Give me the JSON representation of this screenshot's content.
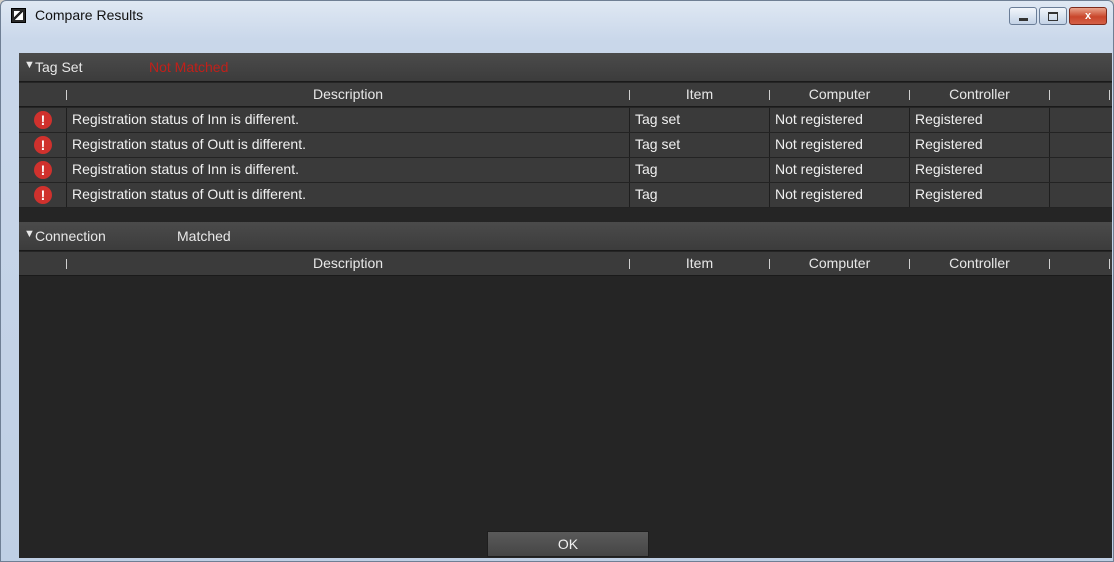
{
  "window": {
    "title": "Compare Results",
    "app_icon": "app-logo-icon",
    "controls": [
      "minimize-icon",
      "maximize-icon",
      "close-icon"
    ],
    "close_glyph": "x"
  },
  "columns": {
    "description": "Description",
    "item": "Item",
    "computer": "Computer",
    "controller": "Controller"
  },
  "sections": [
    {
      "toggle_glyph": "▼",
      "title": "Tag Set",
      "status": "Not Matched",
      "status_color": "#c0201a",
      "rows": [
        {
          "icon": "error-icon",
          "description": "Registration status of Inn is different.",
          "item": "Tag set",
          "computer": "Not registered",
          "controller": "Registered"
        },
        {
          "icon": "error-icon",
          "description": "Registration status of Outt is different.",
          "item": "Tag set",
          "computer": "Not registered",
          "controller": "Registered"
        },
        {
          "icon": "error-icon",
          "description": "Registration status of Inn is different.",
          "item": "Tag",
          "computer": "Not registered",
          "controller": "Registered"
        },
        {
          "icon": "error-icon",
          "description": "Registration status of Outt is different.",
          "item": "Tag",
          "computer": "Not registered",
          "controller": "Registered"
        }
      ]
    },
    {
      "toggle_glyph": "▼",
      "title": "Connection",
      "status": "Matched",
      "status_color": "#e8e8e8",
      "rows": []
    }
  ],
  "ok_label": "OK"
}
